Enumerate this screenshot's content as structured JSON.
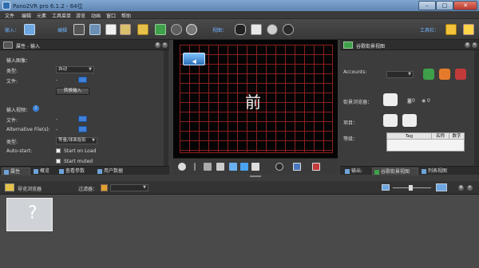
{
  "window": {
    "title": "Pano2VR pro 6.1.2 - 64位",
    "min": "–",
    "max": "□",
    "close": "✕"
  },
  "menu": [
    "文件",
    "编辑",
    "元素",
    "工具菜单",
    "游览",
    "动画",
    "窗口",
    "帮助"
  ],
  "toolbar": {
    "input_label": "输入：",
    "edit_label": "编辑",
    "view_label": "视图：",
    "toolbox_label": "工具栏："
  },
  "left_panel": {
    "title": "属性 - 输入",
    "input_image_section": "输入图像：",
    "type_label": "类型:",
    "type_value": "自动",
    "file_label": "文件:",
    "file_value": "-",
    "convert_button": "转换输入",
    "input_video_section": "输入视频：",
    "video_file_label": "文件:",
    "video_file_value": "-",
    "alt_file_label": "Alternative File(s):",
    "alt_file_value": "-",
    "video_type_label": "类型:",
    "video_type_value": "等量/球面投影",
    "autostart_label": "Auto-start:",
    "start_on_load": "Start on Load",
    "start_muted": "Start muted"
  },
  "left_tabs": [
    "属性",
    "概览",
    "查看参数",
    "用户数据"
  ],
  "viewer": {
    "face_label": "前"
  },
  "right_panel": {
    "title": "谷歌街景视图",
    "accounts_label": "Accounts:",
    "street_browser_label": "街景浏览器：",
    "counter_1": "0",
    "counter_2": "0",
    "items_label": "项目：",
    "level_label": "等级：",
    "table_headers": [
      "Tag",
      "名称",
      "数字"
    ]
  },
  "right_tabs": [
    "输出:",
    "谷歌街景视图",
    "列表视图"
  ],
  "tour": {
    "title": "导览浏览器",
    "filter_label": "过滤器：",
    "filter_value": ""
  },
  "colors": {
    "accent": "#3b82d6",
    "grid": "#8c1f1f",
    "label_blue": "#6fb3ff"
  }
}
